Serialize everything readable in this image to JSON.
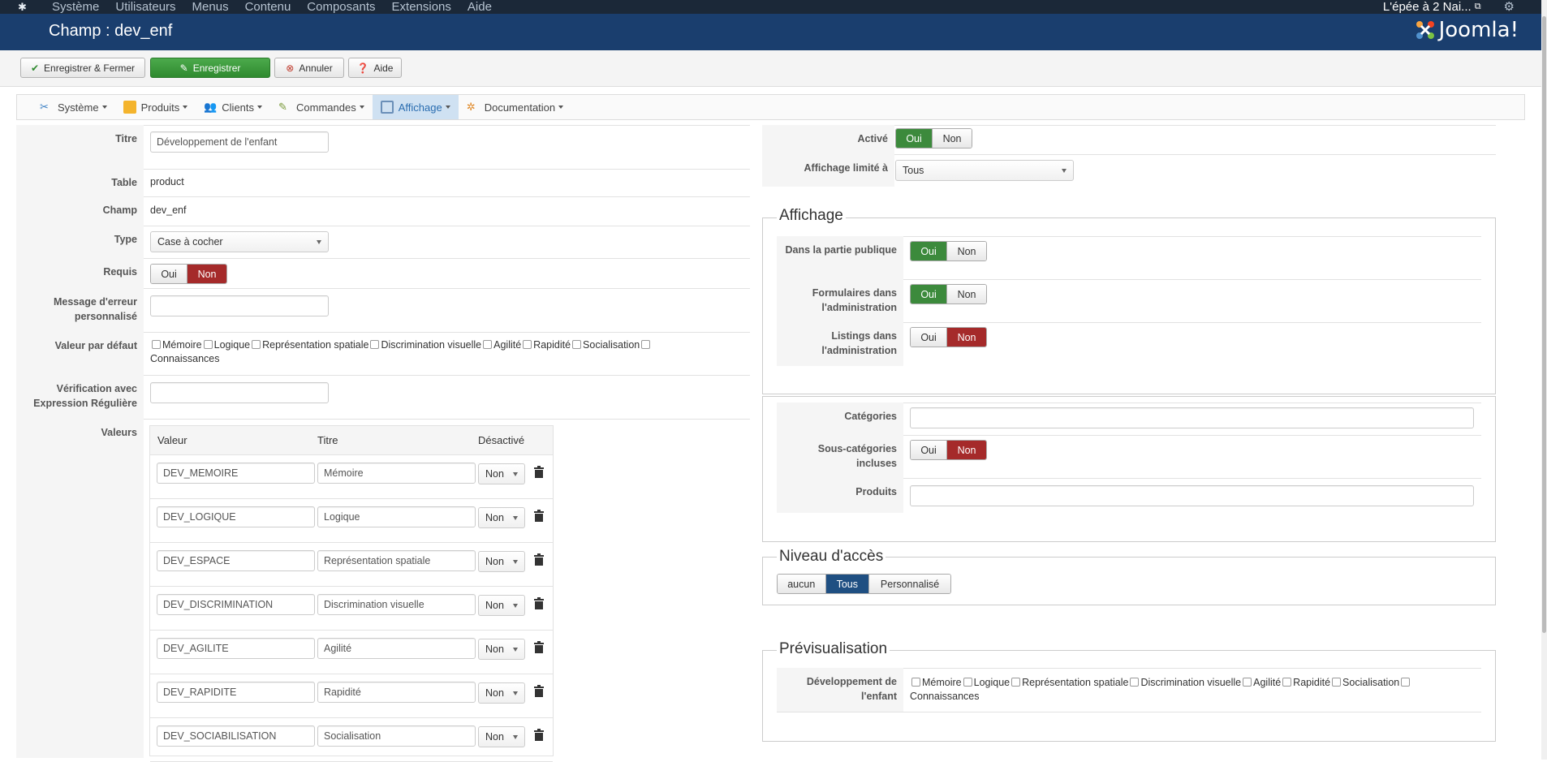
{
  "topnav": {
    "items": [
      "Système",
      "Utilisateurs",
      "Menus",
      "Contenu",
      "Composants",
      "Extensions",
      "Aide"
    ],
    "site_name": "L'épée à 2 Nai..."
  },
  "header": {
    "title": "Champ : dev_enf",
    "brand": "Joomla!"
  },
  "toolbar": {
    "save_close": "Enregistrer & Fermer",
    "save": "Enregistrer",
    "cancel": "Annuler",
    "help": "Aide"
  },
  "hmenu": {
    "items": [
      "Système",
      "Produits",
      "Clients",
      "Commandes",
      "Affichage",
      "Documentation"
    ],
    "active": "Affichage"
  },
  "form": {
    "titre_label": "Titre",
    "titre_value": "Développement de l'enfant",
    "table_label": "Table",
    "table_value": "product",
    "champ_label": "Champ",
    "champ_value": "dev_enf",
    "type_label": "Type",
    "type_value": "Case à cocher",
    "requis_label": "Requis",
    "message_label": "Message d'erreur personnalisé",
    "defaut_label": "Valeur par défaut",
    "verif_label": "Vérification avec Expression Régulière",
    "valeurs_label": "Valeurs",
    "oui": "Oui",
    "non": "Non"
  },
  "checkbox_labels": [
    "Mémoire",
    "Logique",
    "Représentation spatiale",
    "Discrimination visuelle",
    "Agilité",
    "Rapidité",
    "Socialisation",
    "Connaissances"
  ],
  "values_table": {
    "headers": [
      "Valeur",
      "Titre",
      "Désactivé"
    ],
    "rows": [
      {
        "valeur": "DEV_MEMOIRE",
        "titre": "Mémoire",
        "desactive": "Non"
      },
      {
        "valeur": "DEV_LOGIQUE",
        "titre": "Logique",
        "desactive": "Non"
      },
      {
        "valeur": "DEV_ESPACE",
        "titre": "Représentation spatiale",
        "desactive": "Non"
      },
      {
        "valeur": "DEV_DISCRIMINATION",
        "titre": "Discrimination visuelle",
        "desactive": "Non"
      },
      {
        "valeur": "DEV_AGILITE",
        "titre": "Agilité",
        "desactive": "Non"
      },
      {
        "valeur": "DEV_RAPIDITE",
        "titre": "Rapidité",
        "desactive": "Non"
      },
      {
        "valeur": "DEV_SOCIABILISATION",
        "titre": "Socialisation",
        "desactive": "Non"
      }
    ]
  },
  "right": {
    "active_label": "Activé",
    "limite_label": "Affichage limité à",
    "limite_value": "Tous",
    "affichage_legend": "Affichage",
    "publique_label": "Dans la partie publique",
    "formulaires_label": "Formulaires dans l'administration",
    "listings_label": "Listings dans l'administration",
    "categories_label": "Catégories",
    "souscat_label": "Sous-catégories incluses",
    "produits_label": "Produits",
    "acces_legend": "Niveau d'accès",
    "acces_options": [
      "aucun",
      "Tous",
      "Personnalisé"
    ],
    "preview_legend": "Prévisualisation",
    "preview_label": "Développement de l'enfant"
  },
  "colors": {
    "green": "#3c8a3c",
    "red": "#a52a2a",
    "blue": "#1f4f82",
    "header": "#1a3e6e"
  }
}
